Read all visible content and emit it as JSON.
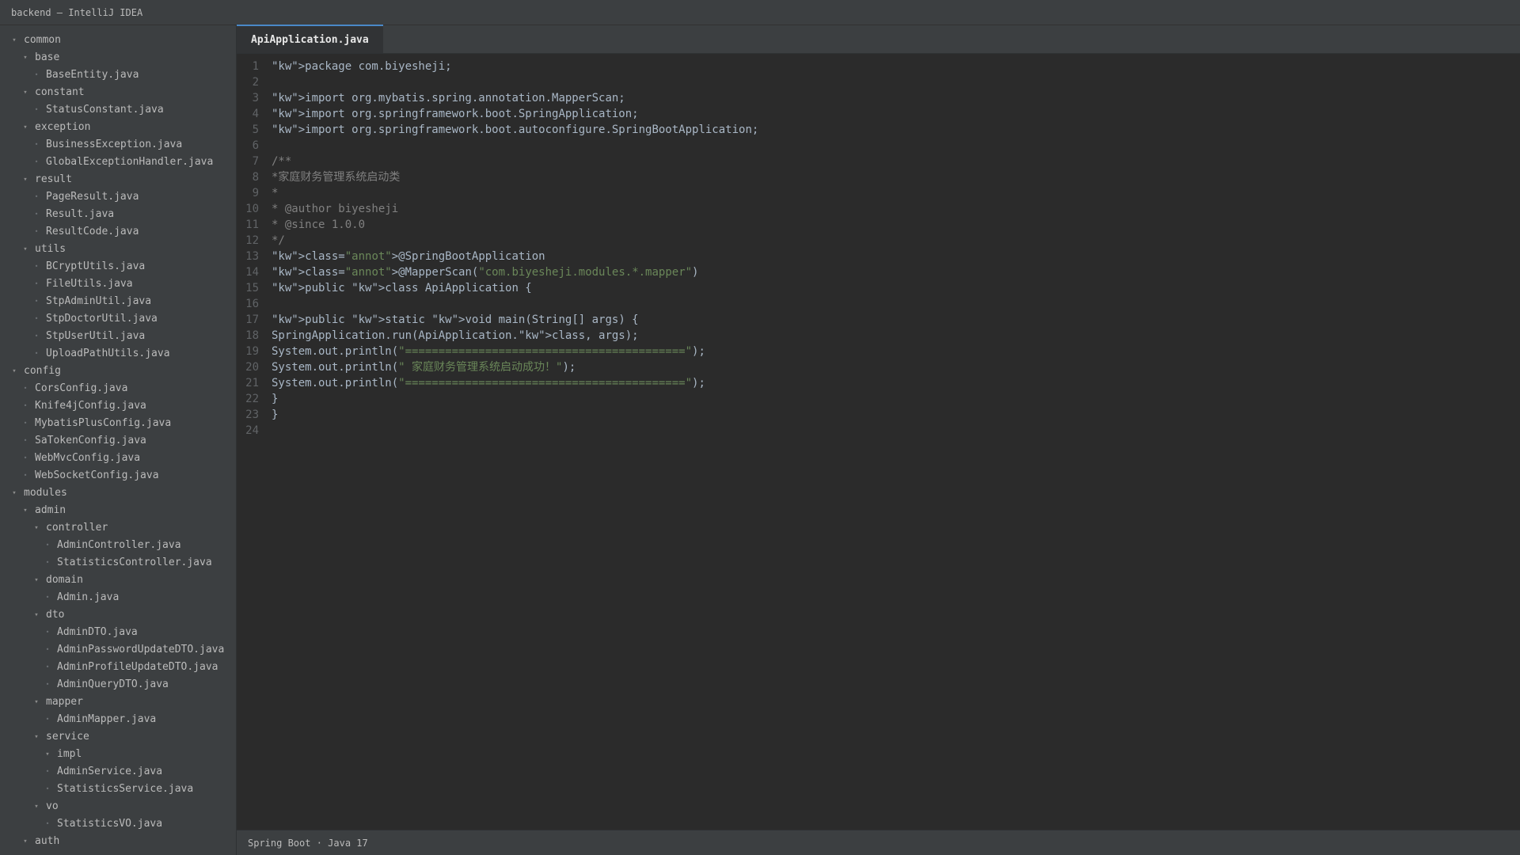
{
  "window": {
    "title": "backend — IntelliJ IDEA"
  },
  "sidebar": {
    "items": [
      {
        "label": "common",
        "type": "folder"
      },
      {
        "label": "base",
        "type": "folder"
      },
      {
        "label": "BaseEntity.java",
        "type": "file"
      },
      {
        "label": "constant",
        "type": "folder"
      },
      {
        "label": "StatusConstant.java",
        "type": "file"
      },
      {
        "label": "exception",
        "type": "folder"
      },
      {
        "label": "BusinessException.java",
        "type": "file"
      },
      {
        "label": "GlobalExceptionHandler.java",
        "type": "file"
      },
      {
        "label": "result",
        "type": "folder"
      },
      {
        "label": "PageResult.java",
        "type": "file"
      },
      {
        "label": "Result.java",
        "type": "file"
      },
      {
        "label": "ResultCode.java",
        "type": "file"
      },
      {
        "label": "utils",
        "type": "folder"
      },
      {
        "label": "BCryptUtils.java",
        "type": "file"
      },
      {
        "label": "FileUtils.java",
        "type": "file"
      },
      {
        "label": "StpAdminUtil.java",
        "type": "file"
      },
      {
        "label": "StpDoctorUtil.java",
        "type": "file"
      },
      {
        "label": "StpUserUtil.java",
        "type": "file"
      },
      {
        "label": "UploadPathUtils.java",
        "type": "file"
      },
      {
        "label": "config",
        "type": "folder"
      },
      {
        "label": "CorsConfig.java",
        "type": "file"
      },
      {
        "label": "Knife4jConfig.java",
        "type": "file"
      },
      {
        "label": "MybatisPlusConfig.java",
        "type": "file"
      },
      {
        "label": "SaTokenConfig.java",
        "type": "file"
      },
      {
        "label": "WebMvcConfig.java",
        "type": "file"
      },
      {
        "label": "WebSocketConfig.java",
        "type": "file"
      },
      {
        "label": "modules",
        "type": "folder"
      },
      {
        "label": "admin",
        "type": "folder"
      },
      {
        "label": "controller",
        "type": "folder"
      },
      {
        "label": "AdminController.java",
        "type": "file"
      },
      {
        "label": "StatisticsController.java",
        "type": "file"
      },
      {
        "label": "domain",
        "type": "folder"
      },
      {
        "label": "Admin.java",
        "type": "file"
      },
      {
        "label": "dto",
        "type": "folder"
      },
      {
        "label": "AdminDTO.java",
        "type": "file"
      },
      {
        "label": "AdminPasswordUpdateDTO.java",
        "type": "file"
      },
      {
        "label": "AdminProfileUpdateDTO.java",
        "type": "file"
      },
      {
        "label": "AdminQueryDTO.java",
        "type": "file"
      },
      {
        "label": "mapper",
        "type": "folder"
      },
      {
        "label": "AdminMapper.java",
        "type": "file"
      },
      {
        "label": "service",
        "type": "folder"
      },
      {
        "label": "impl",
        "type": "folder"
      },
      {
        "label": "AdminService.java",
        "type": "file"
      },
      {
        "label": "StatisticsService.java",
        "type": "file"
      },
      {
        "label": "vo",
        "type": "folder"
      },
      {
        "label": "StatisticsVO.java",
        "type": "file"
      },
      {
        "label": "auth",
        "type": "folder"
      }
    ]
  },
  "editor": {
    "active_tab": "ApiApplication.java",
    "lines": [
      {
        "number": "1",
        "text": "package com.biyesheji;"
      },
      {
        "number": "2",
        "text": ""
      },
      {
        "number": "3",
        "text": "import org.mybatis.spring.annotation.MapperScan;"
      },
      {
        "number": "4",
        "text": "import org.springframework.boot.SpringApplication;"
      },
      {
        "number": "5",
        "text": "import org.springframework.boot.autoconfigure.SpringBootApplication;"
      },
      {
        "number": "6",
        "text": ""
      },
      {
        "number": "7",
        "text": "/**"
      },
      {
        "number": "8",
        "text": "*家庭财务管理系统启动类"
      },
      {
        "number": "9",
        "text": "*"
      },
      {
        "number": "10",
        "text": "* @author biyesheji"
      },
      {
        "number": "11",
        "text": "* @since 1.0.0"
      },
      {
        "number": "12",
        "text": "*/"
      },
      {
        "number": "13",
        "text": "@SpringBootApplication"
      },
      {
        "number": "14",
        "text": "@MapperScan(\"com.biyesheji.modules.*.mapper\")"
      },
      {
        "number": "15",
        "text": "public class ApiApplication {"
      },
      {
        "number": "16",
        "text": ""
      },
      {
        "number": "17",
        "text": "public static void main(String[] args) {"
      },
      {
        "number": "18",
        "text": "SpringApplication.run(ApiApplication.class, args);"
      },
      {
        "number": "19",
        "text": "System.out.println(\"==========================================\");"
      },
      {
        "number": "20",
        "text": "System.out.println(\" 家庭财务管理系统启动成功！\");"
      },
      {
        "number": "21",
        "text": "System.out.println(\"==========================================\");"
      },
      {
        "number": "22",
        "text": "}"
      },
      {
        "number": "23",
        "text": "}"
      },
      {
        "number": "24",
        "text": ""
      }
    ]
  },
  "status": {
    "text": "Spring Boot · Java 17"
  },
  "colors": {
    "keyword": "#cc7832",
    "annotation": "#bbb529",
    "comment": "#808080",
    "string": "#6a8759",
    "text": "#a9b7c6",
    "background": "#2b2b2b",
    "sidebar": "#3c3f41",
    "accent": "#4a88c7"
  },
  "icons": {
    "folder_toggle": "chevron-down-icon",
    "file_marker": "file-dot-icon"
  }
}
